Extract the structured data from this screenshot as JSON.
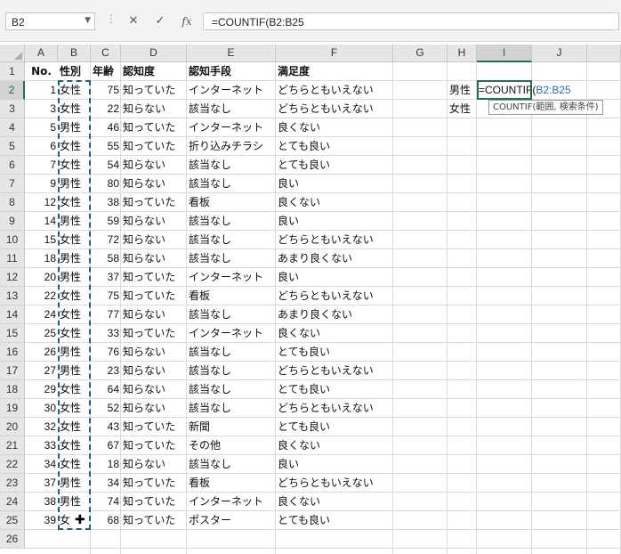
{
  "formula_bar": {
    "name_box": "B2",
    "formula": "=COUNTIF(B2:B25",
    "cancel_glyph": "✕",
    "enter_glyph": "✓",
    "fx_glyph": "fx"
  },
  "columns": [
    "A",
    "B",
    "C",
    "D",
    "E",
    "F",
    "G",
    "H",
    "I",
    "J"
  ],
  "headers": {
    "no": "No.",
    "gender": "性別",
    "age": "年齢",
    "awareness": "認知度",
    "channel": "認知手段",
    "satisfaction": "満足度"
  },
  "rows": [
    {
      "no": "1",
      "gender": "女性",
      "age": "75",
      "awareness": "知っていた",
      "channel": "インターネット",
      "satisfaction": "どちらともいえない"
    },
    {
      "no": "3",
      "gender": "女性",
      "age": "22",
      "awareness": "知らない",
      "channel": "該当なし",
      "satisfaction": "どちらともいえない"
    },
    {
      "no": "5",
      "gender": "男性",
      "age": "46",
      "awareness": "知っていた",
      "channel": "インターネット",
      "satisfaction": "良くない"
    },
    {
      "no": "6",
      "gender": "女性",
      "age": "55",
      "awareness": "知っていた",
      "channel": "折り込みチラシ",
      "satisfaction": "とても良い"
    },
    {
      "no": "7",
      "gender": "女性",
      "age": "54",
      "awareness": "知らない",
      "channel": "該当なし",
      "satisfaction": "とても良い"
    },
    {
      "no": "9",
      "gender": "男性",
      "age": "80",
      "awareness": "知らない",
      "channel": "該当なし",
      "satisfaction": "良い"
    },
    {
      "no": "12",
      "gender": "女性",
      "age": "38",
      "awareness": "知っていた",
      "channel": "看板",
      "satisfaction": "良くない"
    },
    {
      "no": "14",
      "gender": "男性",
      "age": "59",
      "awareness": "知らない",
      "channel": "該当なし",
      "satisfaction": "良い"
    },
    {
      "no": "15",
      "gender": "女性",
      "age": "72",
      "awareness": "知らない",
      "channel": "該当なし",
      "satisfaction": "どちらともいえない"
    },
    {
      "no": "18",
      "gender": "男性",
      "age": "58",
      "awareness": "知らない",
      "channel": "該当なし",
      "satisfaction": "あまり良くない"
    },
    {
      "no": "20",
      "gender": "男性",
      "age": "37",
      "awareness": "知っていた",
      "channel": "インターネット",
      "satisfaction": "良い"
    },
    {
      "no": "22",
      "gender": "女性",
      "age": "75",
      "awareness": "知っていた",
      "channel": "看板",
      "satisfaction": "どちらともいえない"
    },
    {
      "no": "24",
      "gender": "女性",
      "age": "77",
      "awareness": "知らない",
      "channel": "該当なし",
      "satisfaction": "あまり良くない"
    },
    {
      "no": "25",
      "gender": "女性",
      "age": "33",
      "awareness": "知っていた",
      "channel": "インターネット",
      "satisfaction": "良くない"
    },
    {
      "no": "26",
      "gender": "男性",
      "age": "76",
      "awareness": "知らない",
      "channel": "該当なし",
      "satisfaction": "とても良い"
    },
    {
      "no": "27",
      "gender": "男性",
      "age": "23",
      "awareness": "知らない",
      "channel": "該当なし",
      "satisfaction": "どちらともいえない"
    },
    {
      "no": "29",
      "gender": "女性",
      "age": "64",
      "awareness": "知らない",
      "channel": "該当なし",
      "satisfaction": "とても良い"
    },
    {
      "no": "30",
      "gender": "女性",
      "age": "52",
      "awareness": "知らない",
      "channel": "該当なし",
      "satisfaction": "どちらともいえない"
    },
    {
      "no": "32",
      "gender": "女性",
      "age": "43",
      "awareness": "知っていた",
      "channel": "新聞",
      "satisfaction": "とても良い"
    },
    {
      "no": "33",
      "gender": "女性",
      "age": "67",
      "awareness": "知っていた",
      "channel": "その他",
      "satisfaction": "良くない"
    },
    {
      "no": "34",
      "gender": "女性",
      "age": "18",
      "awareness": "知らない",
      "channel": "該当なし",
      "satisfaction": "良い"
    },
    {
      "no": "37",
      "gender": "男性",
      "age": "34",
      "awareness": "知っていた",
      "channel": "看板",
      "satisfaction": "どちらともいえない"
    },
    {
      "no": "38",
      "gender": "男性",
      "age": "74",
      "awareness": "知っていた",
      "channel": "インターネット",
      "satisfaction": "良くない"
    },
    {
      "no": "39",
      "gender": "女",
      "age": "68",
      "awareness": "知っていた",
      "channel": "ポスター",
      "satisfaction": "とても良い"
    }
  ],
  "summary": {
    "male_label": "男性",
    "female_label": "女性",
    "edit_prefix": "=COUNTIF(",
    "edit_ref": "B2:B25"
  },
  "tooltip": "COUNTIF(範囲, 検索条件)",
  "selected_cell": "I2",
  "colors": {
    "header_bg": "#e6e6e6",
    "selected_accent": "#217346",
    "marquee": "#1f5f86",
    "reference_text": "#2f6db3"
  }
}
